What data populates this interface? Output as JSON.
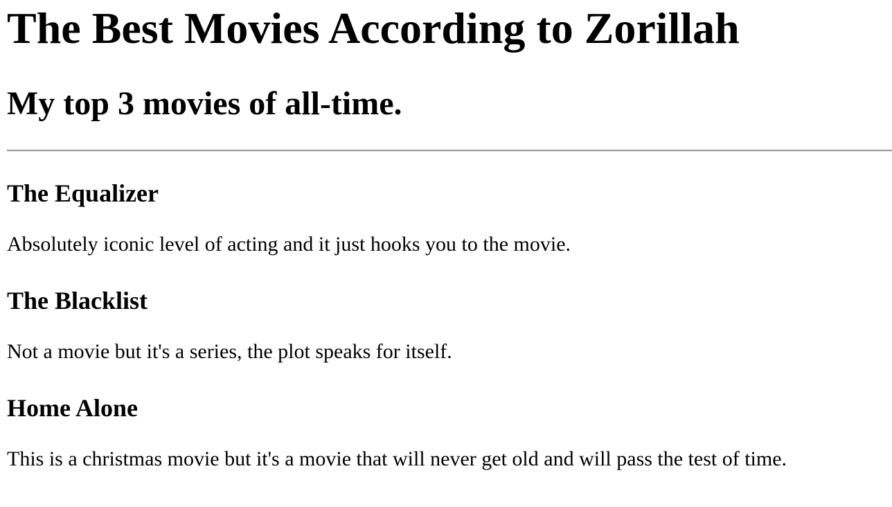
{
  "page": {
    "title": "The Best Movies According to Zorillah",
    "subtitle": "My top 3 movies of all-time."
  },
  "movies": [
    {
      "title": "The Equalizer",
      "description": "Absolutely iconic level of acting and it just hooks you to the movie."
    },
    {
      "title": "The Blacklist",
      "description": "Not a movie but it's a series, the plot speaks for itself."
    },
    {
      "title": "Home Alone",
      "description": "This is a christmas movie but it's a movie that will never get old and will pass the test of time."
    }
  ]
}
